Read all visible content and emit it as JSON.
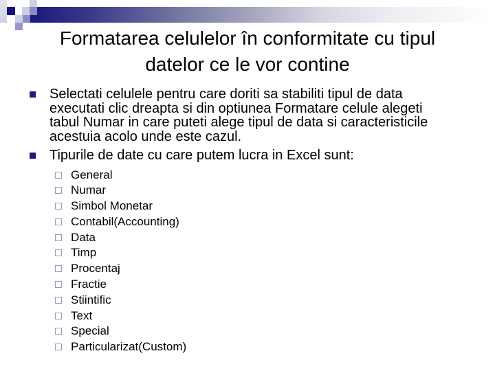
{
  "slide": {
    "title": "Formatarea celulelor în conformitate cu tipul datelor ce le vor contine",
    "bullets": [
      {
        "text": "Selectati celulele pentru care doriti sa stabiliti tipul de data executati clic dreapta si din optiunea Formatare celule alegeti tabul Numar in care puteti alege tipul de data si caracteristicile acestuia acolo unde este cazul.",
        "lines": [
          "Selectati celulele pentru care doriti sa stabiliti tipul de data",
          "executati clic dreapta si din optiunea Formatare celule alegeti",
          "tabul Numar in care puteti alege tipul de data si caracteristicile",
          "acestuia acolo unde este cazul."
        ]
      },
      {
        "text": "Tipurile de date cu care putem lucra in Excel sunt:",
        "lines": [
          "Tipurile de date cu care putem lucra in Excel sunt:"
        ]
      }
    ],
    "sub_items": [
      "General",
      "Numar",
      "Simbol Monetar",
      "Contabil(Accounting)",
      "Data",
      "Timp",
      "Procentaj",
      "Fractie",
      "Stiintific",
      "Text",
      "Special",
      "Particularizat(Custom)"
    ],
    "title_lines": [
      "Formatarea celulelor în conformitate cu tipul",
      "datelor ce le vor contine"
    ]
  },
  "icons": {
    "bullet_level1": "filled-square-bullet",
    "bullet_level2": "hollow-square-bullet"
  },
  "colors": {
    "accent_navy": "#1c1c80",
    "bullet_level2": "#9a99bb"
  }
}
